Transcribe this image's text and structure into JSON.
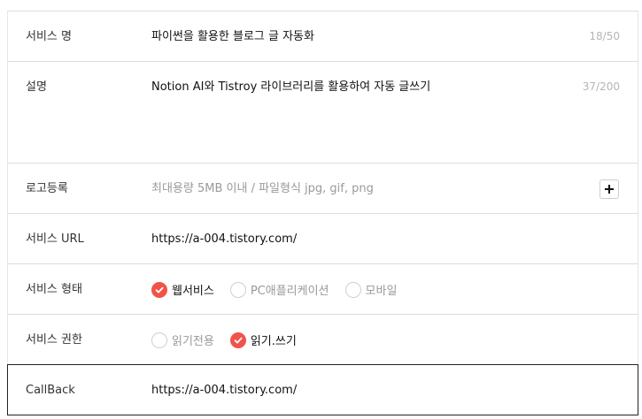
{
  "service_name": {
    "label": "서비스 명",
    "value": "파이썬을 활용한 블로그 글 자동화",
    "counter": "18/50"
  },
  "description": {
    "label": "설명",
    "value": "Notion AI와 Tistroy 라이브러리를 활용하여 자동 글쓰기",
    "counter": "37/200"
  },
  "logo": {
    "label": "로고등록",
    "placeholder": "최대용량 5MB 이내 / 파일형식 jpg, gif, png",
    "add_icon": "plus-icon"
  },
  "service_url": {
    "label": "서비스 URL",
    "value": "https://a-004.tistory.com/"
  },
  "service_type": {
    "label": "서비스 형태",
    "options": [
      {
        "label": "웹서비스",
        "checked": true
      },
      {
        "label": "PC애플리케이션",
        "checked": false
      },
      {
        "label": "모바일",
        "checked": false
      }
    ]
  },
  "service_permission": {
    "label": "서비스 권한",
    "options": [
      {
        "label": "읽기전용",
        "checked": false
      },
      {
        "label": "읽기.쓰기",
        "checked": true
      }
    ]
  },
  "callback": {
    "label": "CallBack",
    "value": "https://a-004.tistory.com/"
  },
  "colors": {
    "accent": "#f0534a",
    "border": "#dcdcdc"
  }
}
